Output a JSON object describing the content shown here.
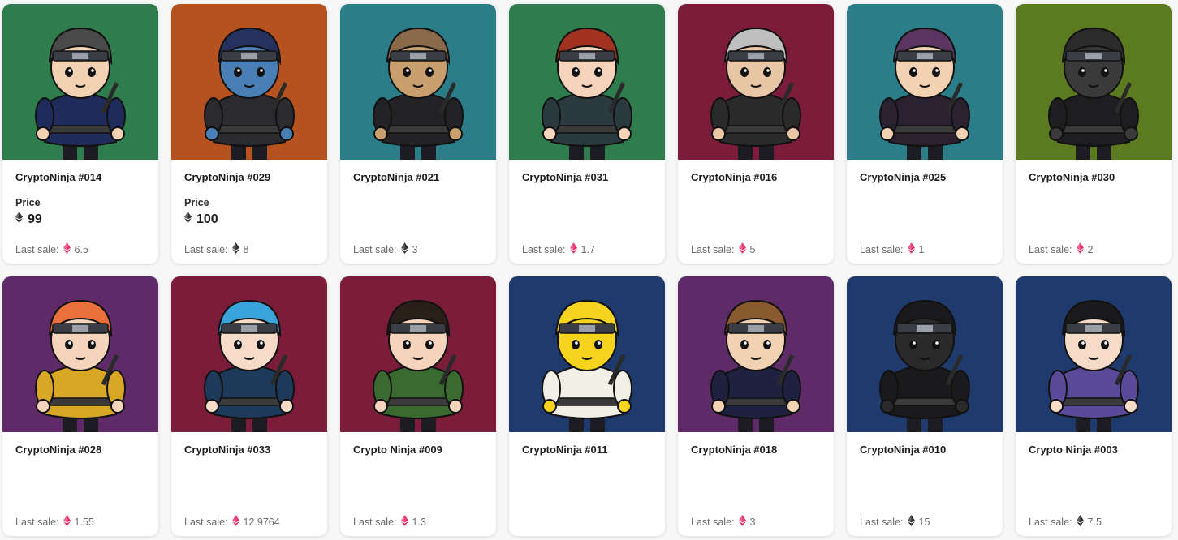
{
  "labels": {
    "price": "Price",
    "last_sale": "Last sale:"
  },
  "colors": {
    "green": "#2f7d4c",
    "orange": "#b5521f",
    "teal": "#2b7d8a",
    "maroon": "#7a1c3a",
    "olive": "#5c7a1f",
    "purple": "#5e2a68",
    "navy": "#1f3b6e"
  },
  "cards": [
    {
      "name": "CryptoNinja #014",
      "bg": "#2f7d4c",
      "outfit": "#1f2b5a",
      "hair": "#4a4a4a",
      "skin": "#f3d1b3",
      "has_price": true,
      "price": "99",
      "last_sale": "6.5",
      "last_sale_currency": "eth-pink"
    },
    {
      "name": "CryptoNinja #029",
      "bg": "#b5521f",
      "outfit": "#2a2a2f",
      "hair": "#27315e",
      "skin": "#4a7fb5",
      "has_price": true,
      "price": "100",
      "last_sale": "8",
      "last_sale_currency": "eth-dark"
    },
    {
      "name": "CryptoNinja #021",
      "bg": "#2b7d8a",
      "outfit": "#232326",
      "hair": "#8a6a4a",
      "skin": "#c9a06d",
      "has_price": false,
      "price": "",
      "last_sale": "3",
      "last_sale_currency": "eth-dark"
    },
    {
      "name": "CryptoNinja #031",
      "bg": "#2f7d4c",
      "outfit": "#2a3a3f",
      "hair": "#a0321f",
      "skin": "#f6d3bb",
      "has_price": false,
      "price": "",
      "last_sale": "1.7",
      "last_sale_currency": "eth-pink"
    },
    {
      "name": "CryptoNinja #016",
      "bg": "#7a1c3a",
      "outfit": "#2a2a2a",
      "hair": "#bfbfbf",
      "skin": "#e9c7a6",
      "has_price": false,
      "price": "",
      "last_sale": "5",
      "last_sale_currency": "eth-pink"
    },
    {
      "name": "CryptoNinja #025",
      "bg": "#2b7d8a",
      "outfit": "#2a2230",
      "hair": "#5a3560",
      "skin": "#f3d1b3",
      "has_price": false,
      "price": "",
      "last_sale": "1",
      "last_sale_currency": "eth-pink"
    },
    {
      "name": "CryptoNinja #030",
      "bg": "#5c7a1f",
      "outfit": "#1e1e20",
      "hair": "#2b2b2b",
      "skin": "#3a3a3a",
      "has_price": false,
      "price": "",
      "last_sale": "2",
      "last_sale_currency": "eth-pink"
    },
    {
      "name": "CryptoNinja #028",
      "bg": "#5e2a68",
      "outfit": "#d9a726",
      "hair": "#e8703a",
      "skin": "#f6d3bb",
      "has_price": false,
      "price": "",
      "last_sale": "1.55",
      "last_sale_currency": "eth-pink"
    },
    {
      "name": "CryptoNinja #033",
      "bg": "#7a1c3a",
      "outfit": "#1e3a5a",
      "hair": "#3aa3d9",
      "skin": "#f6dcc8",
      "has_price": false,
      "price": "",
      "last_sale": "12.9764",
      "last_sale_currency": "eth-pink"
    },
    {
      "name": "Crypto Ninja #009",
      "bg": "#7a1c3a",
      "outfit": "#3a6a2f",
      "hair": "#2a1e18",
      "skin": "#f6d3bb",
      "has_price": false,
      "price": "",
      "last_sale": "1.3",
      "last_sale_currency": "eth-pink"
    },
    {
      "name": "CryptoNinja #011",
      "bg": "#1f3b6e",
      "outfit": "#f2efe6",
      "hair": "#f5d31f",
      "skin": "#f5d31f",
      "has_price": false,
      "price": "",
      "last_sale": "",
      "last_sale_currency": ""
    },
    {
      "name": "CryptoNinja #018",
      "bg": "#5e2a68",
      "outfit": "#1e2140",
      "hair": "#8a5a2f",
      "skin": "#f3d1b3",
      "has_price": false,
      "price": "",
      "last_sale": "3",
      "last_sale_currency": "eth-pink"
    },
    {
      "name": "CryptoNinja #010",
      "bg": "#1f3b6e",
      "outfit": "#1a1a1c",
      "hair": "#1a1a1c",
      "skin": "#2a2a2a",
      "has_price": false,
      "price": "",
      "last_sale": "15",
      "last_sale_currency": "eth-dark"
    },
    {
      "name": "Crypto Ninja #003",
      "bg": "#1f3b6e",
      "outfit": "#5a4a9a",
      "hair": "#1a1a1c",
      "skin": "#f6dcc8",
      "has_price": false,
      "price": "",
      "last_sale": "7.5",
      "last_sale_currency": "eth-dark"
    }
  ]
}
